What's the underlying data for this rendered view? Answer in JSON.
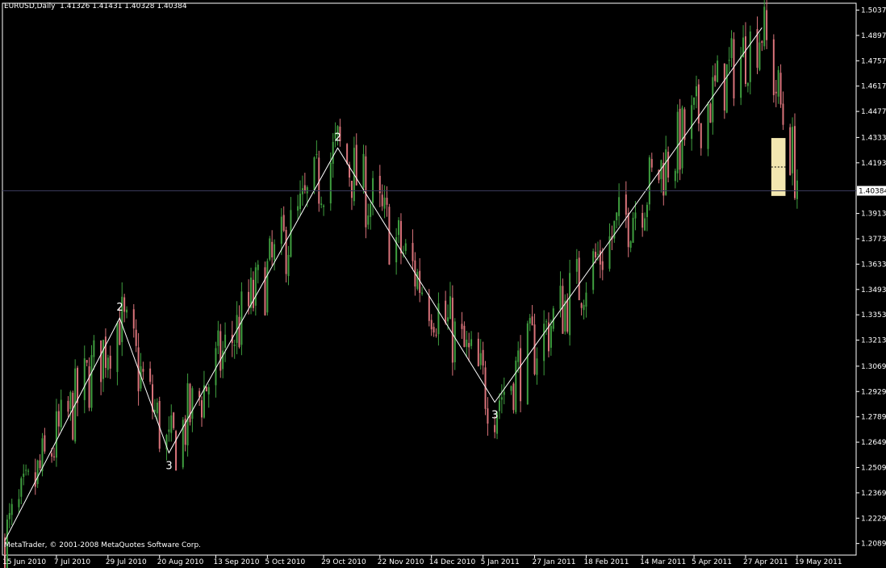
{
  "header": {
    "symbol_tf": "EURUSD,Daily",
    "ohlc": "1.41326 1.41431 1.40328 1.40384"
  },
  "copyright": "MetaTrader, © 2001-2008 MetaQuotes Software Corp.",
  "colors": {
    "background": "#000000",
    "grid_axis": "#ffffff",
    "bull": "#3f9e3f",
    "bear": "#d9737a",
    "zigzag": "#ffffff",
    "highlight": "#f3e7b0",
    "current_price_bg": "#ffffff"
  },
  "chart_data": {
    "type": "candlestick",
    "title": "",
    "symbol": "EURUSD",
    "timeframe": "Daily",
    "ylim": [
      1.2025,
      1.5075
    ],
    "y_ticks": [
      "1.50370",
      "1.48970",
      "1.47570",
      "1.46170",
      "1.44770",
      "1.43330",
      "1.41930",
      "1.40384",
      "1.39130",
      "1.37730",
      "1.36330",
      "1.34930",
      "1.33530",
      "1.32130",
      "1.30690",
      "1.29290",
      "1.27890",
      "1.26490",
      "1.25090",
      "1.23690",
      "1.22290",
      "1.20890"
    ],
    "y_tick_values": [
      1.5037,
      1.4897,
      1.4757,
      1.4617,
      1.4477,
      1.4333,
      1.4193,
      1.40384,
      1.3913,
      1.3773,
      1.3633,
      1.3493,
      1.3353,
      1.3213,
      1.3069,
      1.2929,
      1.2789,
      1.2649,
      1.2509,
      1.2369,
      1.2229,
      1.2089
    ],
    "current_price": "1.40384",
    "x_ticks": [
      {
        "label": "15 Jun 2010",
        "day": 0
      },
      {
        "label": "7 Jul 2010",
        "day": 22
      },
      {
        "label": "29 Jul 2010",
        "day": 44
      },
      {
        "label": "20 Aug 2010",
        "day": 66
      },
      {
        "label": "13 Sep 2010",
        "day": 90
      },
      {
        "label": "5 Oct 2010",
        "day": 112
      },
      {
        "label": "29 Oct 2010",
        "day": 136
      },
      {
        "label": "22 Nov 2010",
        "day": 160
      },
      {
        "label": "14 Dec 2010",
        "day": 182
      },
      {
        "label": "5 Jan 2011",
        "day": 204
      },
      {
        "label": "27 Jan 2011",
        "day": 226
      },
      {
        "label": "18 Feb 2011",
        "day": 248
      },
      {
        "label": "14 Mar 2011",
        "day": 272
      },
      {
        "label": "5 Apr 2011",
        "day": 294
      },
      {
        "label": "27 Apr 2011",
        "day": 316
      },
      {
        "label": "19 May 2011",
        "day": 338
      }
    ],
    "zigzag": [
      {
        "date": "15 Jun 2010",
        "price": 1.2105
      },
      {
        "date": "3 Aug 2010",
        "price": 1.3335,
        "label": "2"
      },
      {
        "date": "24 Aug 2010",
        "price": 1.259,
        "label": "3"
      },
      {
        "date": "4 Nov 2010",
        "price": 1.4275,
        "label": "2"
      },
      {
        "date": "10 Jan 2011",
        "price": 1.287,
        "label": "3"
      },
      {
        "date": "4 May 2011",
        "price": 1.494
      }
    ],
    "highlight_box": {
      "from": "9 May 2011",
      "to": "13 May 2011",
      "high": 1.433,
      "low": 1.401
    },
    "candles_note": "Daily OHLC candles from 15 Jun 2010 to 19 May 2011 following the zigzag path."
  }
}
